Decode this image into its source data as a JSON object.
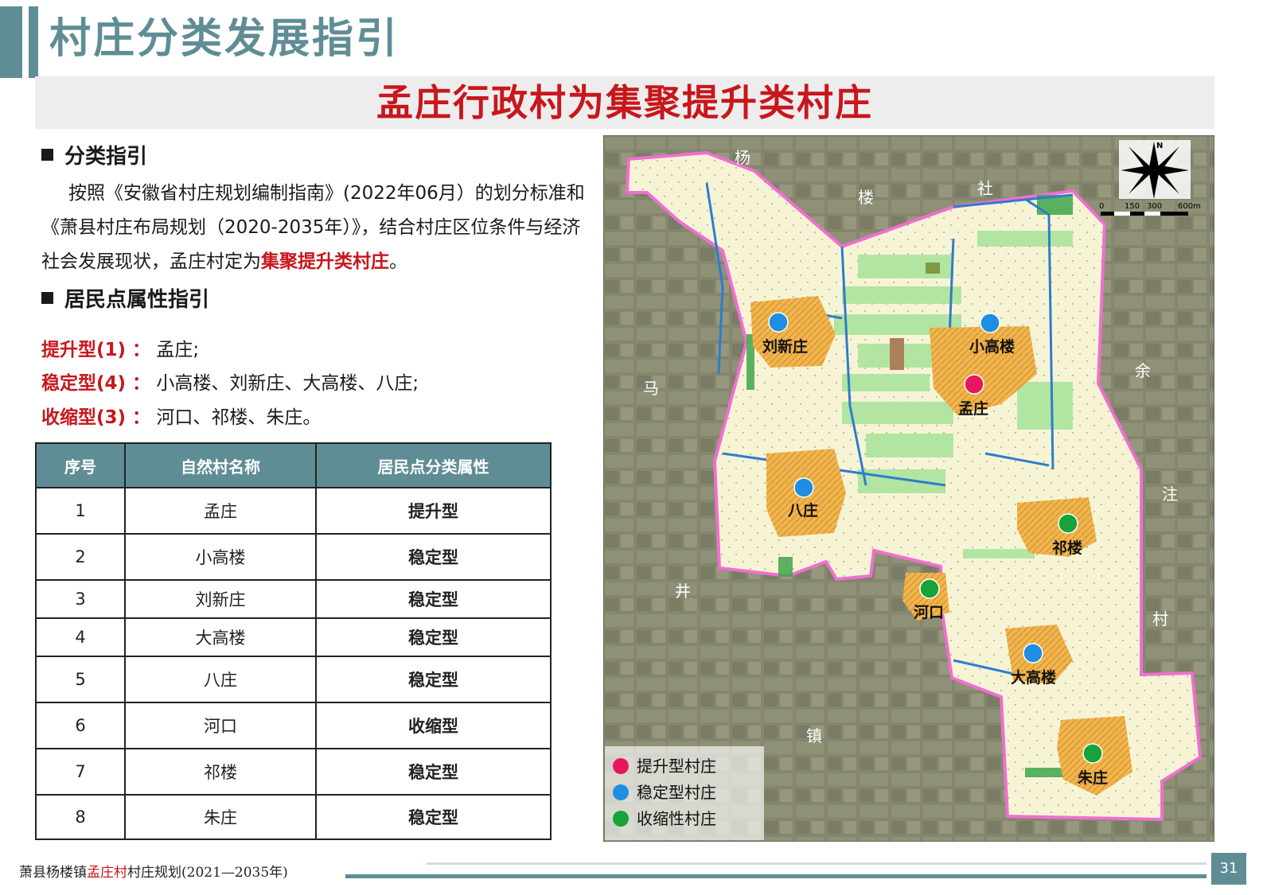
{
  "page_title": "村庄分类发展指引",
  "banner": "孟庄行政村为集聚提升类村庄",
  "section1": {
    "heading": "分类指引",
    "para_a": "按照《安徽省村庄规划编制指南》(2022年06月）的划分标准和《萧县村庄布局规划（2020-2035年）》，结合村庄区位条件与经济社会发展现状，孟庄村定为",
    "para_highlight": "集聚提升类村庄",
    "para_end": "。"
  },
  "section2": {
    "heading": "居民点属性指引",
    "items": [
      {
        "label": "提升型(1) ：",
        "villages": "孟庄;"
      },
      {
        "label": "稳定型(4) ：",
        "villages": "小高楼、刘新庄、大高楼、八庄;"
      },
      {
        "label": "收缩型(3) ：",
        "villages": "河口、祁楼、朱庄。"
      }
    ]
  },
  "table": {
    "headers": [
      "序号",
      "自然村名称",
      "居民点分类属性"
    ],
    "rows": [
      {
        "no": "1",
        "name": "孟庄",
        "type": "提升型"
      },
      {
        "no": "2",
        "name": "小高楼",
        "type": "稳定型"
      },
      {
        "no": "3",
        "name": "刘新庄",
        "type": "稳定型"
      },
      {
        "no": "4",
        "name": "大高楼",
        "type": "稳定型"
      },
      {
        "no": "5",
        "name": "八庄",
        "type": "稳定型"
      },
      {
        "no": "6",
        "name": "河口",
        "type": "收缩型"
      },
      {
        "no": "7",
        "name": "祁楼",
        "type": "稳定型"
      },
      {
        "no": "8",
        "name": "朱庄",
        "type": "稳定型"
      }
    ]
  },
  "map": {
    "compass_letter": "N",
    "scale_labels": [
      "0",
      "150",
      "300",
      "600m"
    ],
    "context_labels": [
      "杨",
      "楼",
      "社",
      "马",
      "余",
      "注",
      "井",
      "村",
      "镇"
    ],
    "villages": [
      {
        "name": "刘新庄",
        "category": "stable"
      },
      {
        "name": "小高楼",
        "category": "stable"
      },
      {
        "name": "孟庄",
        "category": "upgrade"
      },
      {
        "name": "八庄",
        "category": "stable"
      },
      {
        "name": "祁楼",
        "category": "shrink"
      },
      {
        "name": "河口",
        "category": "shrink"
      },
      {
        "name": "大高楼",
        "category": "stable"
      },
      {
        "name": "朱庄",
        "category": "shrink"
      }
    ],
    "legend": [
      {
        "label": "提升型村庄",
        "color": "#e8175d"
      },
      {
        "label": "稳定型村庄",
        "color": "#1e8ee0"
      },
      {
        "label": "收缩性村庄",
        "color": "#15a33a"
      }
    ]
  },
  "footer": {
    "prefix": "萧县杨楼镇",
    "highlight": "孟庄村",
    "suffix": "村庄规划(2021—2035年)",
    "page": "31"
  },
  "colors": {
    "teal": "#5f8d95",
    "red": "#c8161d",
    "blue": "#2d6fb5",
    "green": "#1e9e47"
  }
}
